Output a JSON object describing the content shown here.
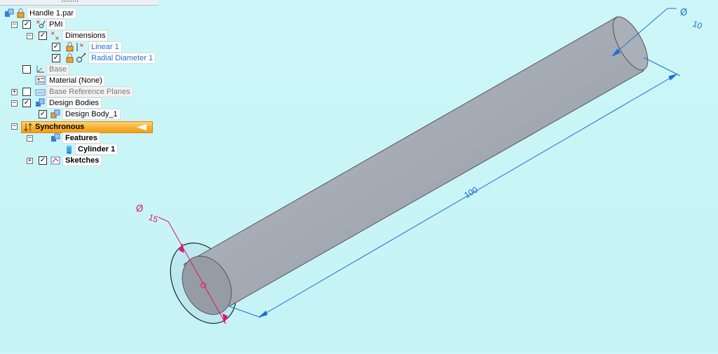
{
  "tree": {
    "root": {
      "label": "Handle 1.par",
      "icon": "part-document-icon"
    },
    "items": [
      {
        "label": "PMI",
        "expander": "minus",
        "checked": true,
        "icon": "pmi-icon"
      },
      {
        "label": "Dimensions",
        "expander": "minus",
        "checked": true,
        "icon": "dimensions-icon"
      },
      {
        "label": "Linear 1",
        "checked": true,
        "icon": "linear-dimension-icon",
        "lock": true
      },
      {
        "label": "Radial Diameter 1",
        "checked": true,
        "icon": "radial-diameter-icon",
        "lock": true
      },
      {
        "label": "Base",
        "checked": false,
        "icon": "coordinate-system-icon"
      },
      {
        "label": "Material (None)",
        "icon": "material-icon"
      },
      {
        "label": "Base Reference Planes",
        "expander": "plus",
        "checked": false,
        "icon": "reference-planes-icon"
      },
      {
        "label": "Design Bodies",
        "expander": "minus",
        "checked": true,
        "icon": "design-bodies-icon"
      },
      {
        "label": "Design Body_1",
        "checked": true,
        "icon": "design-body-icon"
      },
      {
        "label": "Synchronous",
        "expander": "minus",
        "icon": "synchronous-icon"
      },
      {
        "label": "Features",
        "expander": "minus",
        "icon": "features-icon"
      },
      {
        "label": "Cylinder 1",
        "icon": "cylinder-icon"
      },
      {
        "label": "Sketches",
        "expander": "plus",
        "checked": true,
        "icon": "sketches-icon"
      }
    ]
  },
  "model": {
    "dim_length": "100",
    "dim_top_diameter_symbol": "Ø",
    "dim_top_diameter_value": "10",
    "dim_base_diameter_symbol": "Ø",
    "dim_base_diameter_value": "15"
  },
  "colors": {
    "background": "#c9f5f7",
    "cylinder": "#a3aab3",
    "dimension_blue": "#1f6fd1",
    "dimension_magenta": "#e0156e",
    "sync_bar": "#f6ae2a"
  }
}
